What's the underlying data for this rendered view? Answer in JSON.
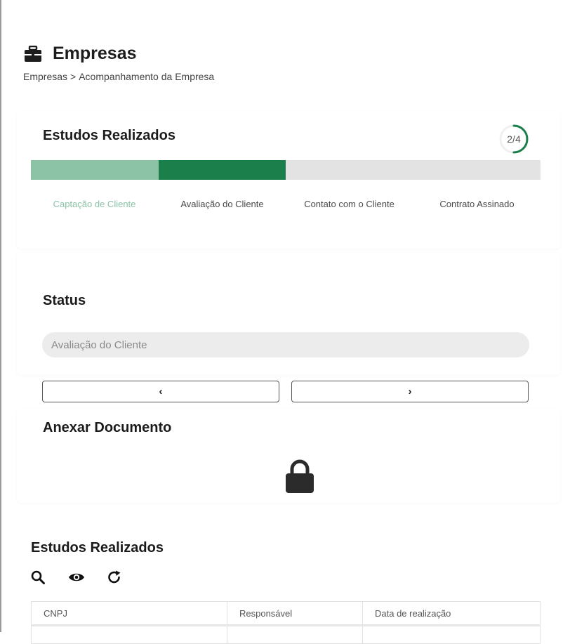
{
  "header": {
    "icon": "briefcase-icon",
    "title": "Empresas",
    "breadcrumb": [
      "Empresas",
      "Acompanhamento da Empresa"
    ],
    "breadcrumb_separator": ">"
  },
  "studies_progress": {
    "title": "Estudos Realizados",
    "counter": "2/4",
    "progress_fraction": 0.5,
    "steps": [
      {
        "label": "Captação de Cliente",
        "state": "done",
        "color": "#8cc3a7",
        "label_color": "#8cc3a7"
      },
      {
        "label": "Avaliação do Cliente",
        "state": "current",
        "color": "#1a7f4b",
        "label_color": "#4a4a4a"
      },
      {
        "label": "Contato com o Cliente",
        "state": "pending",
        "color": "#e3e3e3",
        "label_color": "#4a4a4a"
      },
      {
        "label": "Contrato Assinado",
        "state": "pending",
        "color": "#e3e3e3",
        "label_color": "#4a4a4a"
      }
    ],
    "accent": "#1a7f4b"
  },
  "status": {
    "title": "Status",
    "value": "Avaliação do Cliente",
    "prev_label": "‹",
    "next_label": "›"
  },
  "attachment": {
    "title": "Anexar Documento",
    "icon": "lock-icon"
  },
  "studies_table": {
    "title": "Estudos Realizados",
    "toolbar_icons": [
      "search-icon",
      "eye-icon",
      "refresh-icon"
    ],
    "columns": [
      "CNPJ",
      "Responsável",
      "Data de realização"
    ]
  }
}
